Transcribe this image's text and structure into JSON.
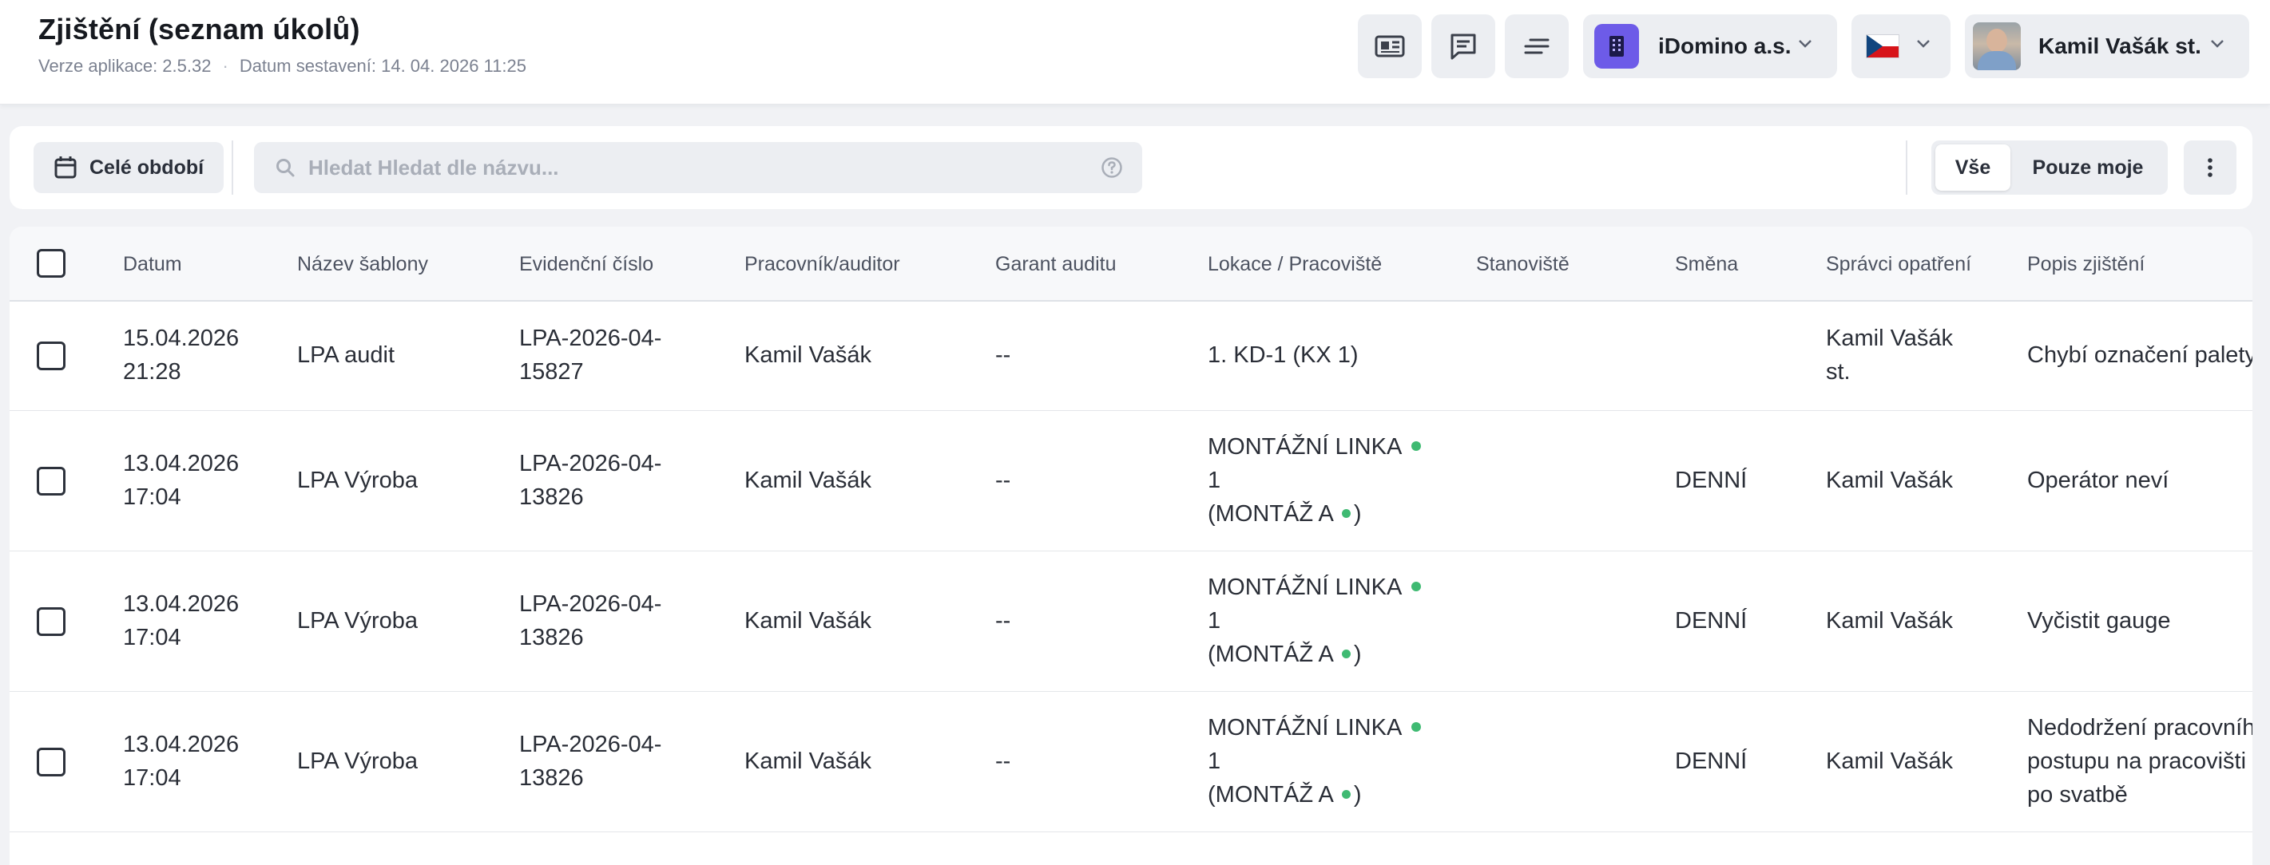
{
  "header": {
    "title": "Zjištění (seznam úkolů)",
    "version_label": "Verze aplikace: 2.5.32",
    "build_label": "Datum sestavení: 14. 04. 2026 11:25",
    "separator": "·",
    "icons": [
      "news-icon",
      "comment-icon",
      "notes-icon"
    ],
    "company": "iDomino a.s.",
    "language_flag": "cz-flag-icon",
    "user": "Kamil Vašák st."
  },
  "toolbar": {
    "period_label": "Celé období",
    "search_placeholder": "Hledat Hledat dle názvu...",
    "filter_all": "Vše",
    "filter_mine": "Pouze moje",
    "active_filter": "Vše"
  },
  "table": {
    "columns": {
      "datum": "Datum",
      "sablona": "Název šablony",
      "cislo": "Evidenční číslo",
      "pracovnik": "Pracovník/auditor",
      "garant": "Garant auditu",
      "lokace": "Lokace / Pracoviště",
      "stanoviste": "Stanoviště",
      "smena": "Směna",
      "spravci": "Správci opatření",
      "popis": "Popis zjištění"
    },
    "rows": [
      {
        "datum_date": "15.04.2026",
        "datum_time": "21:28",
        "sablona": "LPA audit",
        "cislo_1": "LPA-2026-04-",
        "cislo_2": "15827",
        "pracovnik": "Kamil Vašák",
        "garant": "--",
        "lokace": "1. KD-1 (KX 1)",
        "stanoviste": "",
        "smena": "",
        "spravci_1": "Kamil Vašák",
        "spravci_2": "st.",
        "popis": "Chybí označení palety"
      },
      {
        "datum_date": "13.04.2026",
        "datum_time": "17:04",
        "sablona": "LPA Výroba",
        "cislo_1": "LPA-2026-04-",
        "cislo_2": "13826",
        "pracovnik": "Kamil Vašák",
        "garant": "--",
        "lokace_1": "MONTÁŽNÍ LINKA",
        "lokace_2": "1",
        "lokace_3": "(MONTÁŽ A",
        "lokace_close": ")",
        "stanoviste": "",
        "smena": "DENNÍ",
        "spravci_1": "Kamil Vašák",
        "popis": "Operátor neví"
      },
      {
        "datum_date": "13.04.2026",
        "datum_time": "17:04",
        "sablona": "LPA Výroba",
        "cislo_1": "LPA-2026-04-",
        "cislo_2": "13826",
        "pracovnik": "Kamil Vašák",
        "garant": "--",
        "lokace_1": "MONTÁŽNÍ LINKA",
        "lokace_2": "1",
        "lokace_3": "(MONTÁŽ A",
        "lokace_close": ")",
        "stanoviste": "",
        "smena": "DENNÍ",
        "spravci_1": "Kamil Vašák",
        "popis": "Vyčistit gauge"
      },
      {
        "datum_date": "13.04.2026",
        "datum_time": "17:04",
        "sablona": "LPA Výroba",
        "cislo_1": "LPA-2026-04-",
        "cislo_2": "13826",
        "pracovnik": "Kamil Vašák",
        "garant": "--",
        "lokace_1": "MONTÁŽNÍ LINKA",
        "lokace_2": "1",
        "lokace_3": "(MONTÁŽ A",
        "lokace_close": ")",
        "stanoviste": "",
        "smena": "DENNÍ",
        "spravci_1": "Kamil Vašák",
        "popis_1": "Nedodržení pracovního",
        "popis_2": "postupu na pracovišti",
        "popis_3": "po svatbě"
      }
    ]
  },
  "colors": {
    "accent_company": "#6d5be8",
    "status_dot": "#3fba72"
  }
}
